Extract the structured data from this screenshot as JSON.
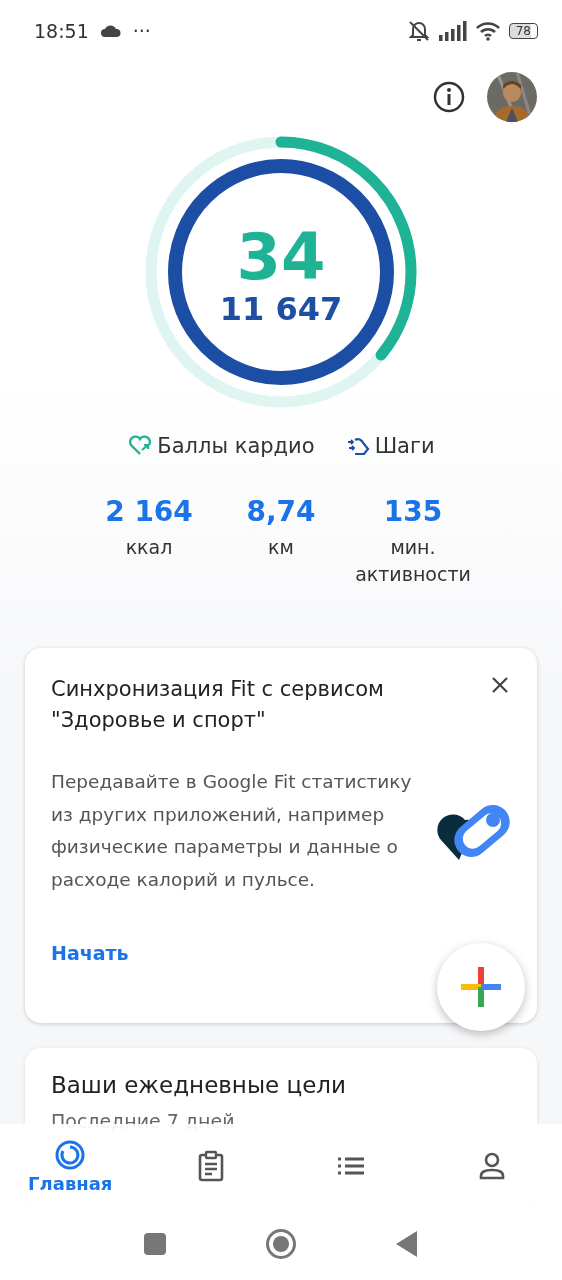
{
  "status_bar": {
    "time": "18:51",
    "overflow": "···",
    "battery": "78"
  },
  "rings": {
    "heart_points": "34",
    "steps": "11 647",
    "arcs": [
      {
        "kind": "heart",
        "level": 0.36
      },
      {
        "kind": "steps",
        "level": 1
      }
    ]
  },
  "legend": [
    {
      "kind": "heart",
      "label": "Баллы кардио"
    },
    {
      "kind": "steps",
      "label": "Шаги"
    }
  ],
  "stats": [
    {
      "value": "2 164",
      "unit": "ккал"
    },
    {
      "value": "8,74",
      "unit": "км"
    },
    {
      "value": "135",
      "unit": "мин. активности"
    }
  ],
  "sync_card": {
    "title": "Синхронизация Fit с сервисом \"Здоровье и спорт\"",
    "body": "Передавайте в Google Fit статистику из других приложений, например физические параметры и данные о расходе калорий и пульсе.",
    "action": "Начать"
  },
  "goals_card": {
    "title": "Ваши ежедневные цели",
    "subtitle": "Последние 7 дней"
  },
  "bottom_nav": [
    {
      "kind": "home",
      "label": "Главная",
      "selected": true
    },
    {
      "kind": "journal",
      "selected": false
    },
    {
      "kind": "browse",
      "selected": false
    },
    {
      "kind": "profile",
      "selected": false
    }
  ]
}
